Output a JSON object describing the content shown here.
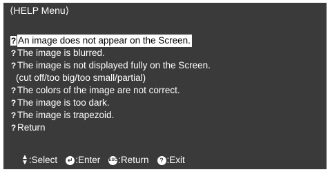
{
  "menu": {
    "title": "⟨HELP Menu⟩",
    "items": [
      {
        "label": "An image does not appear on the Screen.",
        "selected": true
      },
      {
        "label": "The image is blurred."
      },
      {
        "label": "The image is not displayed fully on the Screen.",
        "subtext": "(cut off/too big/too small/partial)"
      },
      {
        "label": "The colors of the image are not correct."
      },
      {
        "label": "The image is too dark."
      },
      {
        "label": "The image is trapezoid."
      },
      {
        "label": "Return"
      }
    ]
  },
  "footer": {
    "select_label": ":Select",
    "enter_label": ":Enter",
    "return_label": ":Return",
    "exit_label": ":Exit",
    "select_icon": "updown-arrows-icon",
    "enter_icon": "enter-icon",
    "return_icon": "esc-icon",
    "exit_icon": "help-icon"
  },
  "colors": {
    "background": "#3a3a3a",
    "text": "#ffffff",
    "highlight_bg": "#ffffff",
    "highlight_text": "#000000"
  }
}
